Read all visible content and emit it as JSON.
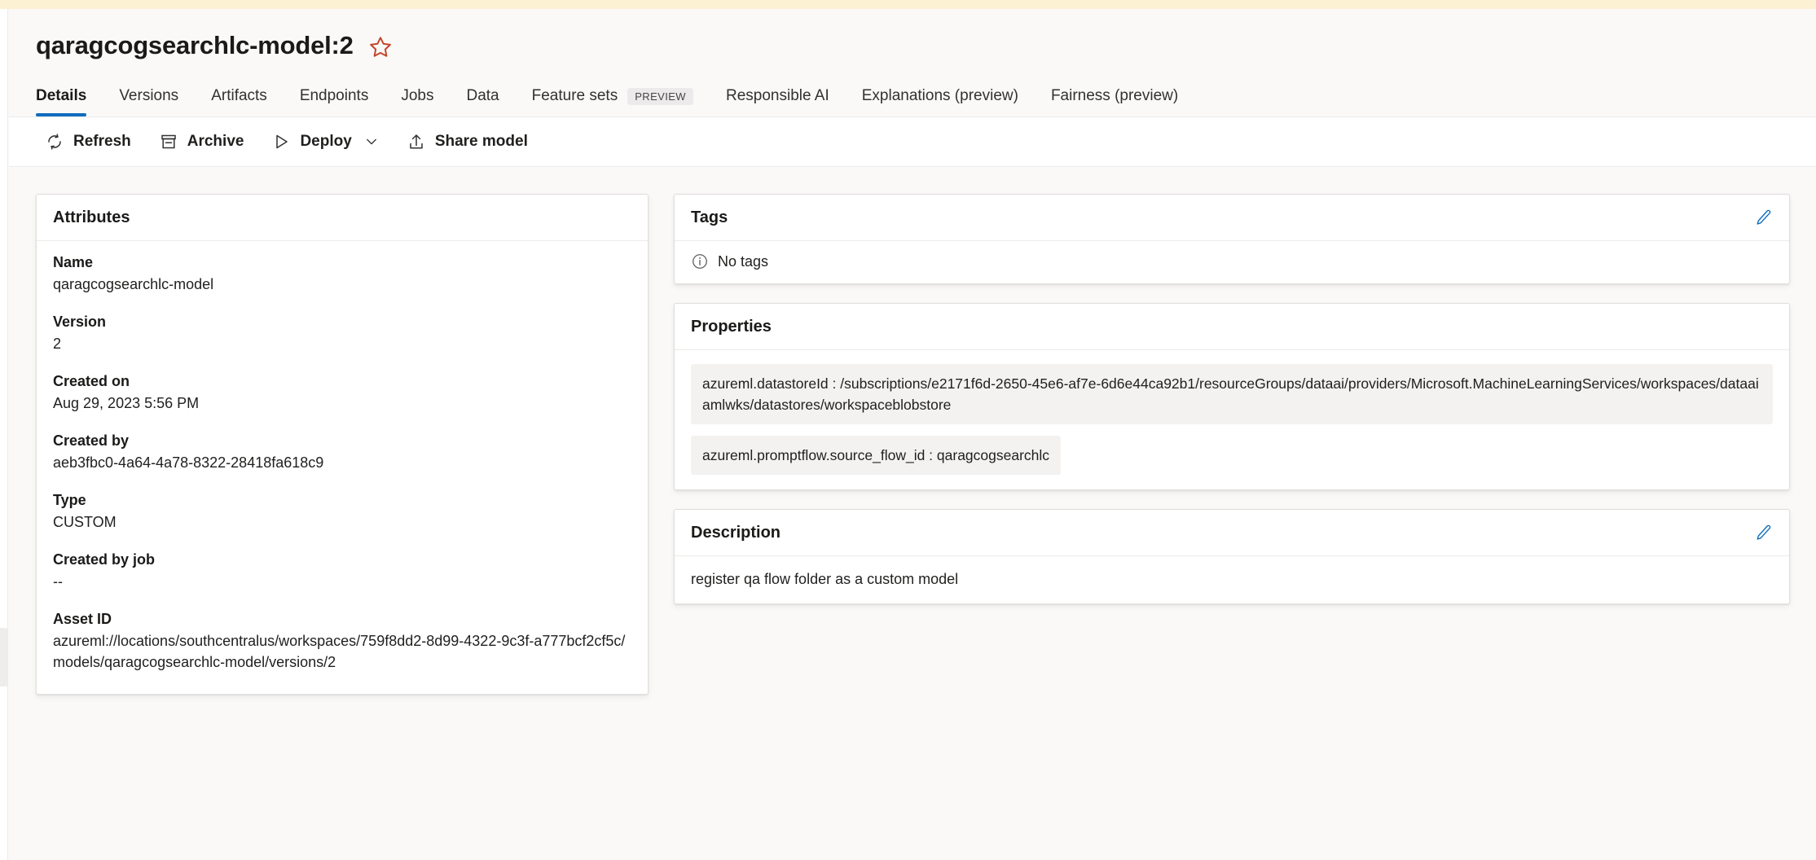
{
  "header": {
    "title": "qaragcogsearchlc-model:2",
    "favorite_icon": "star-icon"
  },
  "tabs": [
    {
      "label": "Details",
      "active": true
    },
    {
      "label": "Versions",
      "active": false
    },
    {
      "label": "Artifacts",
      "active": false
    },
    {
      "label": "Endpoints",
      "active": false
    },
    {
      "label": "Jobs",
      "active": false
    },
    {
      "label": "Data",
      "active": false
    },
    {
      "label": "Feature sets",
      "active": false,
      "badge": "PREVIEW"
    },
    {
      "label": "Responsible AI",
      "active": false
    },
    {
      "label": "Explanations (preview)",
      "active": false
    },
    {
      "label": "Fairness (preview)",
      "active": false
    }
  ],
  "commandbar": {
    "refresh": "Refresh",
    "archive": "Archive",
    "deploy": "Deploy",
    "share": "Share model"
  },
  "attributes": {
    "title": "Attributes",
    "items": [
      {
        "label": "Name",
        "value": "qaragcogsearchlc-model"
      },
      {
        "label": "Version",
        "value": "2"
      },
      {
        "label": "Created on",
        "value": "Aug 29, 2023 5:56 PM"
      },
      {
        "label": "Created by",
        "value": "aeb3fbc0-4a64-4a78-8322-28418fa618c9"
      },
      {
        "label": "Type",
        "value": "CUSTOM"
      },
      {
        "label": "Created by job",
        "value": "--"
      },
      {
        "label": "Asset ID",
        "value": "azureml://locations/southcentralus/workspaces/759f8dd2-8d99-4322-9c3f-a777bcf2cf5c/models/qaragcogsearchlc-model/versions/2"
      }
    ]
  },
  "tags": {
    "title": "Tags",
    "empty_text": "No tags",
    "edit_label": "edit-tags"
  },
  "properties": {
    "title": "Properties",
    "items": [
      "azureml.datastoreId : /subscriptions/e2171f6d-2650-45e6-af7e-6d6e44ca92b1/resourceGroups/dataai/providers/Microsoft.MachineLearningServices/workspaces/dataaiamlwks/datastores/workspaceblobstore",
      "azureml.promptflow.source_flow_id : qaragcogsearchlc"
    ]
  },
  "description": {
    "title": "Description",
    "text": "register qa flow folder as a custom model",
    "edit_label": "edit-description"
  },
  "colors": {
    "accent": "#0f6cbd",
    "banner": "#fdf1d3",
    "favorite": "#c4452a",
    "card_bg": "#ffffff",
    "page_bg": "#faf9f8",
    "pill_bg": "#f3f2f1"
  }
}
